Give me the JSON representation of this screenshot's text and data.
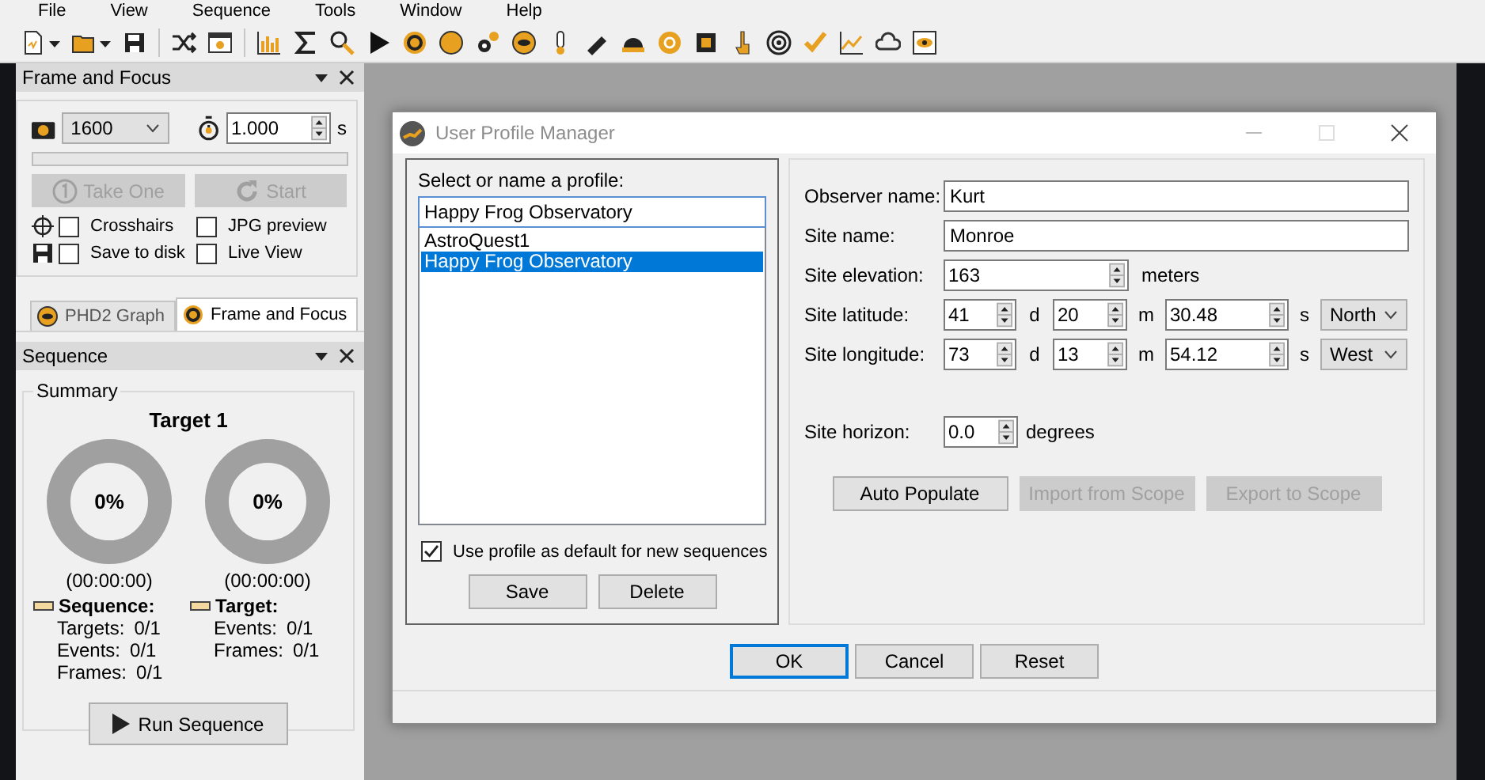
{
  "menu": [
    "File",
    "View",
    "Sequence",
    "Tools",
    "Window",
    "Help"
  ],
  "frame_and_focus": {
    "title": "Frame and Focus",
    "gain": "1600",
    "exposure": "1.000",
    "exposure_unit": "s",
    "progress": {
      "level": 0
    },
    "actions": [
      {
        "label": "Take One",
        "disabled": true,
        "kind": "single"
      },
      {
        "label": "Start",
        "disabled": true,
        "kind": "loop"
      }
    ],
    "options": [
      {
        "label": "Crosshairs",
        "checked": false,
        "kind": "crosshair"
      },
      {
        "label": "JPG preview",
        "checked": false,
        "kind": "plain"
      },
      {
        "label": "Save to disk",
        "checked": false,
        "kind": "save"
      },
      {
        "label": "Live View",
        "checked": false,
        "kind": "plain"
      }
    ]
  },
  "dock_tabs": [
    {
      "label": "PHD2 Graph",
      "selected": false,
      "kind": "guide"
    },
    {
      "label": "Frame and Focus",
      "selected": true,
      "kind": "aperture"
    }
  ],
  "sequence": {
    "title": "Sequence",
    "group": "Summary",
    "target_name": "Target 1",
    "rings": [
      {
        "percent": "0%",
        "time": "(00:00:00)"
      },
      {
        "percent": "0%",
        "time": "(00:00:00)"
      }
    ],
    "stats": [
      {
        "heading": "Sequence:",
        "rows": [
          {
            "label": "Targets:",
            "value": "0/1"
          },
          {
            "label": "Events:",
            "value": "0/1"
          },
          {
            "label": "Frames:",
            "value": "0/1"
          }
        ]
      },
      {
        "heading": "Target:",
        "rows": [
          {
            "label": "Events:",
            "value": "0/1"
          },
          {
            "label": "Frames:",
            "value": "0/1"
          }
        ]
      }
    ],
    "run_button": "Run Sequence"
  },
  "dialog": {
    "title": "User Profile Manager",
    "profiles": {
      "prompt": "Select or name a profile:",
      "name": "Happy Frog Observatory",
      "items": [
        {
          "label": "AstroQuest1",
          "selected": false
        },
        {
          "label": "Happy Frog Observatory",
          "selected": true
        }
      ],
      "default_option": {
        "label": "Use profile as default for new sequences",
        "checked": true
      },
      "buttons": [
        "Save",
        "Delete"
      ]
    },
    "site": {
      "observer": {
        "label": "Observer name:",
        "value": "Kurt"
      },
      "site_name": {
        "label": "Site name:",
        "value": "Monroe"
      },
      "elevation": {
        "label": "Site elevation:",
        "value": "163",
        "unit": "meters"
      },
      "coordinates": [
        {
          "label": "Site latitude:",
          "degrees": "41",
          "d": "d",
          "minutes": "20",
          "m": "m",
          "seconds": "30.48",
          "s": "s",
          "direction": "North"
        },
        {
          "label": "Site longitude:",
          "degrees": "73",
          "d": "d",
          "minutes": "13",
          "m": "m",
          "seconds": "54.12",
          "s": "s",
          "direction": "West"
        }
      ],
      "horizon": {
        "label": "Site horizon:",
        "value": "0.0",
        "unit": "degrees"
      },
      "buttons": [
        {
          "label": "Auto Populate",
          "disabled": false
        },
        {
          "label": "Import from Scope",
          "disabled": true
        },
        {
          "label": "Export to Scope",
          "disabled": true
        }
      ]
    },
    "buttons": [
      {
        "label": "OK",
        "focused": true
      },
      {
        "label": "Cancel",
        "focused": false
      },
      {
        "label": "Reset",
        "focused": false
      }
    ]
  }
}
